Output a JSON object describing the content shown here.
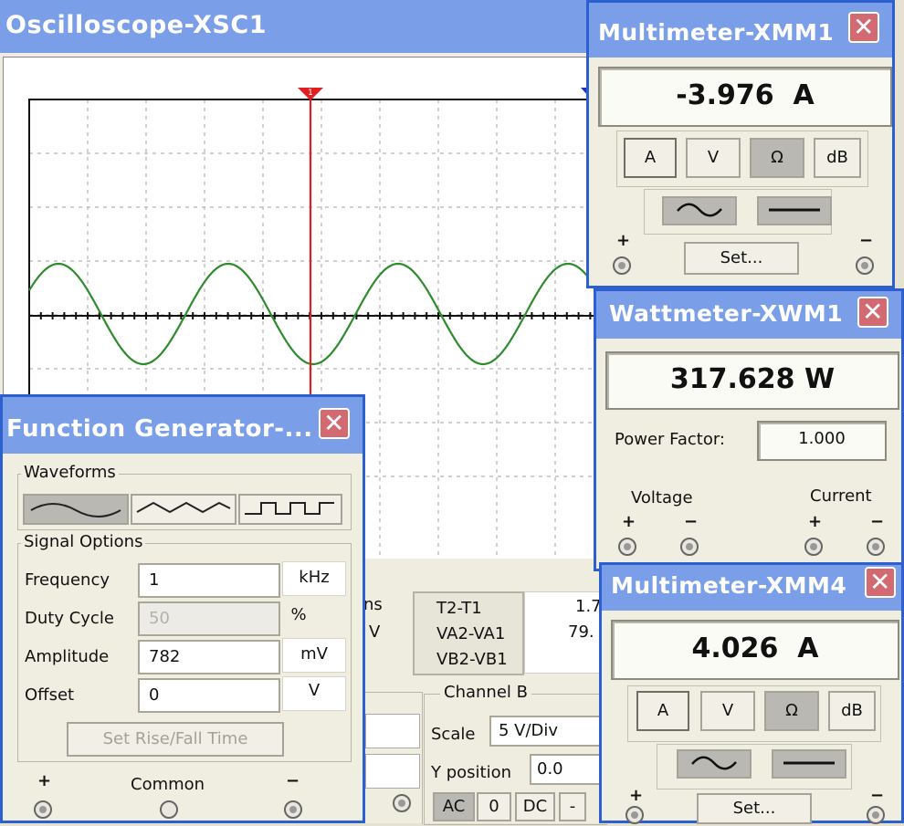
{
  "oscilloscope": {
    "title": "Oscilloscope-XSC1",
    "table_fragment": {
      "t1_col_a": "ns",
      "t1_col_b": "V",
      "t2_rows": [
        "T2-T1",
        "VA2-VA1",
        "VB2-VB1"
      ],
      "val_a": "1.7",
      "val_b": "79."
    },
    "channel_b": {
      "label": "Channel B",
      "scale_label": "Scale",
      "scale_value": "5 V/Div",
      "ypos_label": "Y position",
      "ypos_value": "0.0",
      "coupling": [
        "AC",
        "0",
        "DC",
        "-"
      ]
    },
    "trace_color": "#2e8b2e",
    "cursor_color": "#e02020"
  },
  "function_generator": {
    "title": "Function Generator-...",
    "waveforms_label": "Waveforms",
    "signal_options_label": "Signal Options",
    "rows": [
      {
        "label": "Frequency",
        "value": "1",
        "unit": "kHz"
      },
      {
        "label": "Duty Cycle",
        "value": "50",
        "unit": "%"
      },
      {
        "label": "Amplitude",
        "value": "782",
        "unit": "mV"
      },
      {
        "label": "Offset",
        "value": "0",
        "unit": "V"
      }
    ],
    "rise_fall_button": "Set Rise/Fall Time",
    "terminals": {
      "plus": "+",
      "common": "Common",
      "minus": "−"
    }
  },
  "multimeter1": {
    "title": "Multimeter-XMM1",
    "reading": "-3.976  A",
    "modes": [
      "A",
      "V",
      "Ω",
      "dB"
    ],
    "set_label": "Set...",
    "plus": "+",
    "minus": "−"
  },
  "wattmeter": {
    "title": "Wattmeter-XWM1",
    "reading": "317.628 W",
    "pf_label": "Power Factor:",
    "pf_value": "1.000",
    "voltage_label": "Voltage",
    "current_label": "Current",
    "plus": "+",
    "minus": "−"
  },
  "multimeter4": {
    "title": "Multimeter-XMM4",
    "reading": "4.026  A",
    "modes": [
      "A",
      "V",
      "Ω",
      "dB"
    ],
    "set_label": "Set...",
    "plus": "+",
    "minus": "−"
  },
  "colors": {
    "title_bar": "#7a9ee8",
    "window_border": "#2c5fd0",
    "close_button": "#d36a72",
    "panel": "#f0ede1"
  }
}
